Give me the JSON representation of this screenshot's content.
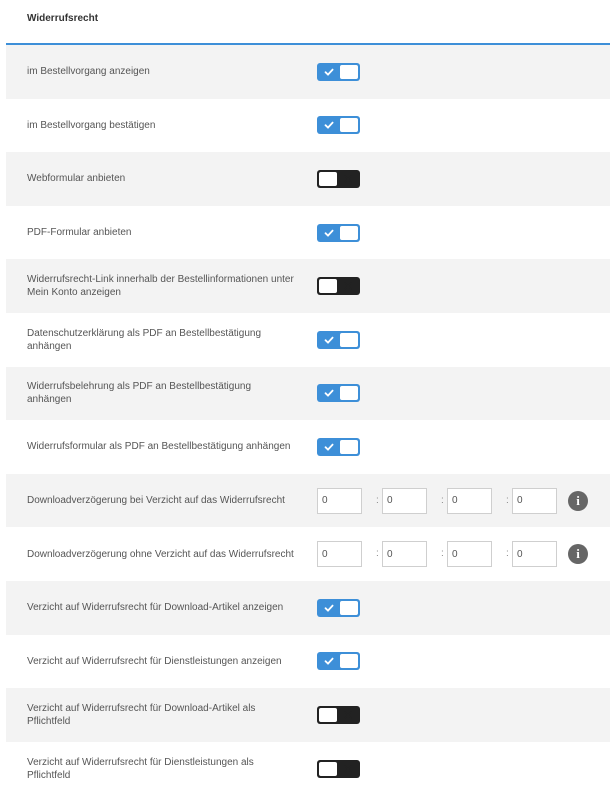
{
  "section": {
    "title": "Widerrufsrecht"
  },
  "rows": [
    {
      "label": "im Bestellvorgang anzeigen",
      "type": "toggle",
      "checked": true
    },
    {
      "label": "im Bestellvorgang bestätigen",
      "type": "toggle",
      "checked": true
    },
    {
      "label": "Webformular anbieten",
      "type": "toggle",
      "checked": false
    },
    {
      "label": "PDF-Formular anbieten",
      "type": "toggle",
      "checked": true
    },
    {
      "label": "Widerrufsrecht-Link innerhalb der Bestellinformationen unter Mein Konto anzeigen",
      "type": "toggle",
      "checked": false
    },
    {
      "label": "Datenschutzerklärung als PDF an Bestellbestätigung anhängen",
      "type": "toggle",
      "checked": true
    },
    {
      "label": "Widerrufsbelehrung als PDF an Bestellbestätigung anhängen",
      "type": "toggle",
      "checked": true
    },
    {
      "label": "Widerrufsformular als PDF an Bestellbestätigung anhängen",
      "type": "toggle",
      "checked": true
    },
    {
      "label": "Downloadverzögerung bei Verzicht auf das Widerrufsrecht",
      "type": "duration",
      "values": [
        "0",
        "0",
        "0",
        "0"
      ],
      "separator": ":",
      "icon": "info-icon"
    },
    {
      "label": "Downloadverzögerung ohne Verzicht auf das Widerrufsrecht",
      "type": "duration",
      "values": [
        "0",
        "0",
        "0",
        "0"
      ],
      "separator": ":",
      "icon": "info-icon"
    },
    {
      "label": "Verzicht auf Widerrufsrecht für Download-Artikel anzeigen",
      "type": "toggle",
      "checked": true
    },
    {
      "label": "Verzicht auf Widerrufsrecht für Dienstleistungen anzeigen",
      "type": "toggle",
      "checked": true
    },
    {
      "label": "Verzicht auf Widerrufsrecht für Download-Artikel als Pflichtfeld",
      "type": "toggle",
      "checked": false
    },
    {
      "label": "Verzicht auf Widerrufsrecht für Dienstleistungen als Pflichtfeld",
      "type": "toggle",
      "checked": false
    }
  ],
  "colors": {
    "accent": "#3d8fd8",
    "toggle_off": "#222222",
    "row_alt": "#f3f3f3"
  }
}
